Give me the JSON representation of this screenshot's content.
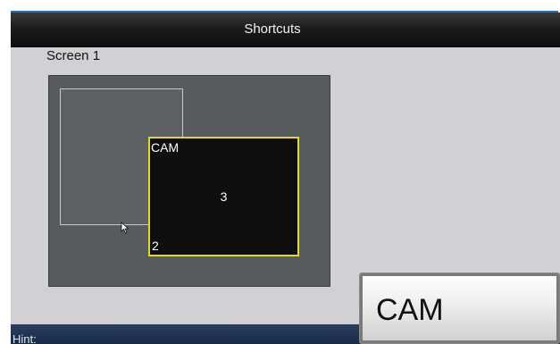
{
  "window": {
    "title": "Shortcuts"
  },
  "screen": {
    "label": "Screen 1"
  },
  "layout": {
    "selected_window": {
      "label": "CAM",
      "position": "3",
      "channel": "2"
    },
    "accent_color": "#e2d634"
  },
  "hint": {
    "label": "Hint:"
  },
  "button": {
    "label": "CAM"
  },
  "icons": {
    "cursor": "pointer-cursor-icon"
  }
}
